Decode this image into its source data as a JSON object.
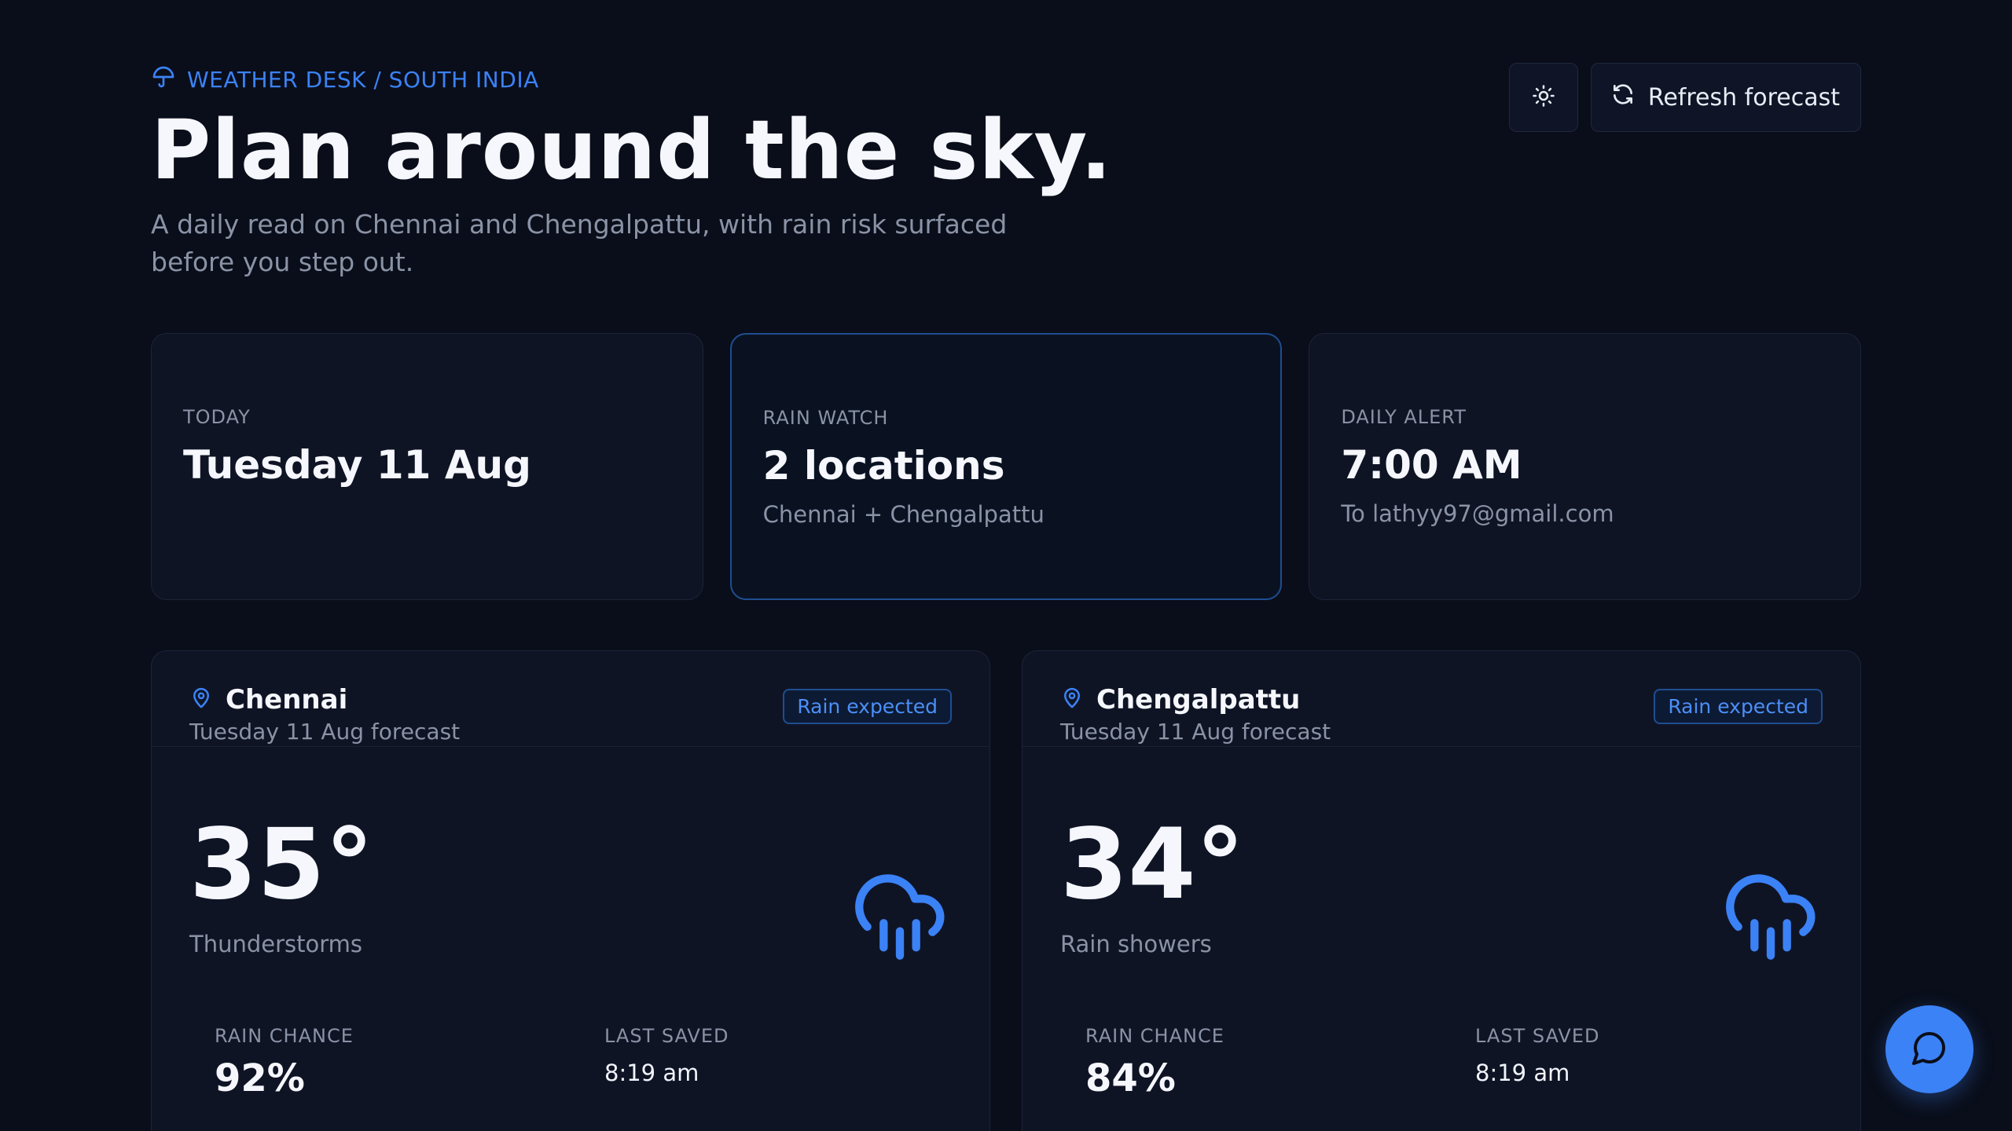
{
  "header": {
    "eyebrow": "WEATHER DESK / SOUTH INDIA",
    "title": "Plan around the sky.",
    "subtitle": "A daily read on Chennai and Chengalpattu, with rain risk surfaced before you step out.",
    "refresh_label": "Refresh forecast"
  },
  "stats": [
    {
      "label": "TODAY",
      "value": "Tuesday 11 Aug",
      "note": ""
    },
    {
      "label": "RAIN WATCH",
      "value": "2 locations",
      "note": "Chennai + Chengalpattu"
    },
    {
      "label": "DAILY ALERT",
      "value": "7:00 AM",
      "note": "To lathyy97@gmail.com"
    }
  ],
  "locations": [
    {
      "name": "Chennai",
      "subtitle": "Tuesday 11 Aug forecast",
      "badge": "Rain expected",
      "temperature": "35°",
      "condition": "Thunderstorms",
      "rain_chance_label": "RAIN CHANCE",
      "rain_chance": "92%",
      "last_saved_label": "LAST SAVED",
      "last_saved": "8:19 am"
    },
    {
      "name": "Chengalpattu",
      "subtitle": "Tuesday 11 Aug forecast",
      "badge": "Rain expected",
      "temperature": "34°",
      "condition": "Rain showers",
      "rain_chance_label": "RAIN CHANCE",
      "rain_chance": "84%",
      "last_saved_label": "LAST SAVED",
      "last_saved": "8:19 am"
    }
  ],
  "icons": {
    "eyebrow": "umbrella-icon",
    "theme_toggle": "sun-icon",
    "refresh": "refresh-icon",
    "location": "map-pin-icon",
    "weather": "cloud-rain-icon",
    "chat": "chat-bubble-icon"
  },
  "colors": {
    "background": "#0a0e1a",
    "card": "#0f1425",
    "accent": "#3b82f6",
    "muted_text": "#8a93a6"
  }
}
